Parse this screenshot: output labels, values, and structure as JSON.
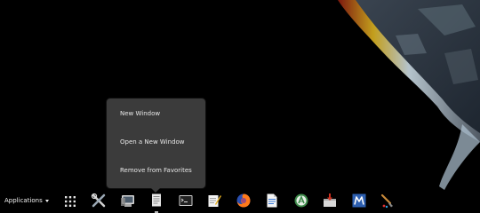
{
  "desktop": {
    "wallpaper": "earth-at-night-from-space",
    "background_color": "#000000"
  },
  "context_menu": {
    "items": [
      {
        "label": "New Window"
      },
      {
        "label": "Open a New Window"
      },
      {
        "label": "Remove from Favorites"
      }
    ]
  },
  "dock": {
    "applications_label": "Applications",
    "applications_icon": "caret-down-icon",
    "show_apps_icon": "grid-icon",
    "favorites": [
      {
        "icon": "settings-tools-icon"
      },
      {
        "icon": "system-monitor-icon"
      },
      {
        "icon": "document-viewer-icon",
        "active": true
      },
      {
        "icon": "terminal-icon"
      },
      {
        "icon": "text-editor-icon"
      },
      {
        "icon": "firefox-icon"
      },
      {
        "icon": "writer-document-icon"
      },
      {
        "icon": "android-studio-icon"
      },
      {
        "icon": "software-installer-icon"
      },
      {
        "icon": "mousepad-icon"
      },
      {
        "icon": "paint-brush-icon"
      }
    ]
  }
}
